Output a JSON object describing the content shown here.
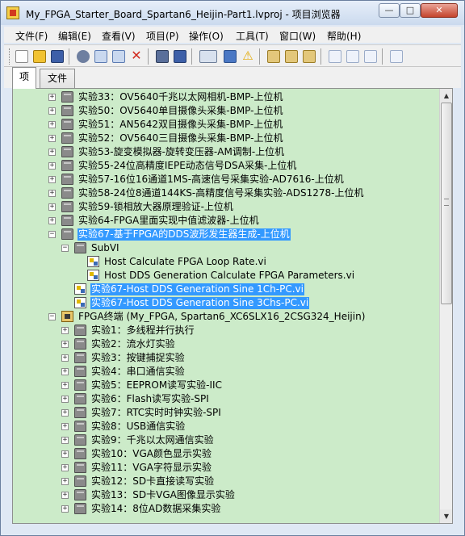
{
  "window": {
    "title": "My_FPGA_Starter_Board_Spartan6_Heijin-Part1.lvproj - 项目浏览器",
    "min_glyph": "—",
    "max_glyph": "□",
    "close_glyph": "✕"
  },
  "menu": [
    "文件(F)",
    "编辑(E)",
    "查看(V)",
    "项目(P)",
    "操作(O)",
    "工具(T)",
    "窗口(W)",
    "帮助(H)"
  ],
  "toolbar": {
    "icons": [
      "new-icon",
      "open-icon",
      "save-all-icon",
      "cut-icon",
      "copy-icon",
      "paste-icon",
      "delete-icon",
      "project-properties-icon",
      "save-icon",
      "view-icon",
      "build-icon",
      "warning-icon",
      "filter-icon",
      "resolve-icon",
      "refresh-icon",
      "add-icon",
      "undo-icon",
      "redo-icon",
      "new-item-icon"
    ]
  },
  "tabs": [
    "项",
    "文件"
  ],
  "tree": [
    {
      "label": "实验33：OV5640千兆以太网相机-BMP-上位机",
      "icon": "folder",
      "expanded": false,
      "depth": 0
    },
    {
      "label": "实验50：OV5640单目摄像头采集-BMP-上位机",
      "icon": "folder",
      "expanded": false,
      "depth": 0
    },
    {
      "label": "实验51：AN5642双目摄像头采集-BMP-上位机",
      "icon": "folder",
      "expanded": false,
      "depth": 0
    },
    {
      "label": "实验52：OV5640三目摄像头采集-BMP-上位机",
      "icon": "folder",
      "expanded": false,
      "depth": 0
    },
    {
      "label": "实验53-旋变模拟器-旋转变压器-AM调制-上位机",
      "icon": "folder",
      "expanded": false,
      "depth": 0
    },
    {
      "label": "实验55-24位高精度IEPE动态信号DSA采集-上位机",
      "icon": "folder",
      "expanded": false,
      "depth": 0
    },
    {
      "label": "实验57-16位16通道1MS-高速信号采集实验-AD7616-上位机",
      "icon": "folder",
      "expanded": false,
      "depth": 0
    },
    {
      "label": "实验58-24位8通道144KS-高精度信号采集实验-ADS1278-上位机",
      "icon": "folder",
      "expanded": false,
      "depth": 0
    },
    {
      "label": "实验59-锁相放大器原理验证-上位机",
      "icon": "folder",
      "expanded": false,
      "depth": 0
    },
    {
      "label": "实验64-FPGA里面实现中值滤波器-上位机",
      "icon": "folder",
      "expanded": false,
      "depth": 0
    },
    {
      "label": "实验67-基于FPGA的DDS波形发生器生成-上位机",
      "icon": "folder",
      "expanded": true,
      "depth": 0,
      "selected": true
    },
    {
      "label": "SubVI",
      "icon": "folder",
      "expanded": true,
      "depth": 1
    },
    {
      "label": "Host Calculate FPGA Loop Rate.vi",
      "icon": "vi",
      "depth": 2
    },
    {
      "label": "Host DDS Generation Calculate FPGA Parameters.vi",
      "icon": "vi",
      "depth": 2
    },
    {
      "label": "实验67-Host DDS Generation Sine 1Ch-PC.vi",
      "icon": "vi",
      "depth": 1,
      "selected": true
    },
    {
      "label": "实验67-Host DDS Generation Sine 3Chs-PC.vi",
      "icon": "vi",
      "depth": 1,
      "selected": true
    },
    {
      "label": "FPGA终端 (My_FPGA, Spartan6_XC6SLX16_2CSG324_Heijin)",
      "icon": "target",
      "expanded": true,
      "depth": -1
    },
    {
      "label": "实验1：多线程并行执行",
      "icon": "folder",
      "expanded": false,
      "depth": 1
    },
    {
      "label": "实验2：流水灯实验",
      "icon": "folder",
      "expanded": false,
      "depth": 1
    },
    {
      "label": "实验3：按键捕捉实验",
      "icon": "folder",
      "expanded": false,
      "depth": 1
    },
    {
      "label": "实验4：串口通信实验",
      "icon": "folder",
      "expanded": false,
      "depth": 1
    },
    {
      "label": "实验5：EEPROM读写实验-IIC",
      "icon": "folder",
      "expanded": false,
      "depth": 1
    },
    {
      "label": "实验6：Flash读写实验-SPI",
      "icon": "folder",
      "expanded": false,
      "depth": 1
    },
    {
      "label": "实验7：RTC实时时钟实验-SPI",
      "icon": "folder",
      "expanded": false,
      "depth": 1
    },
    {
      "label": "实验8：USB通信实验",
      "icon": "folder",
      "expanded": false,
      "depth": 1
    },
    {
      "label": "实验9：千兆以太网通信实验",
      "icon": "folder",
      "expanded": false,
      "depth": 1
    },
    {
      "label": "实验10：VGA颜色显示实验",
      "icon": "folder",
      "expanded": false,
      "depth": 1
    },
    {
      "label": "实验11：VGA字符显示实验",
      "icon": "folder",
      "expanded": false,
      "depth": 1
    },
    {
      "label": "实验12：SD卡直接读写实验",
      "icon": "folder",
      "expanded": false,
      "depth": 1
    },
    {
      "label": "实验13：SD卡VGA图像显示实验",
      "icon": "folder",
      "expanded": false,
      "depth": 1
    },
    {
      "label": "实验14：8位AD数据采集实验",
      "icon": "folder",
      "expanded": false,
      "depth": 1
    }
  ],
  "scrollbar": {
    "up_glyph": "▲",
    "down_glyph": "▼"
  }
}
